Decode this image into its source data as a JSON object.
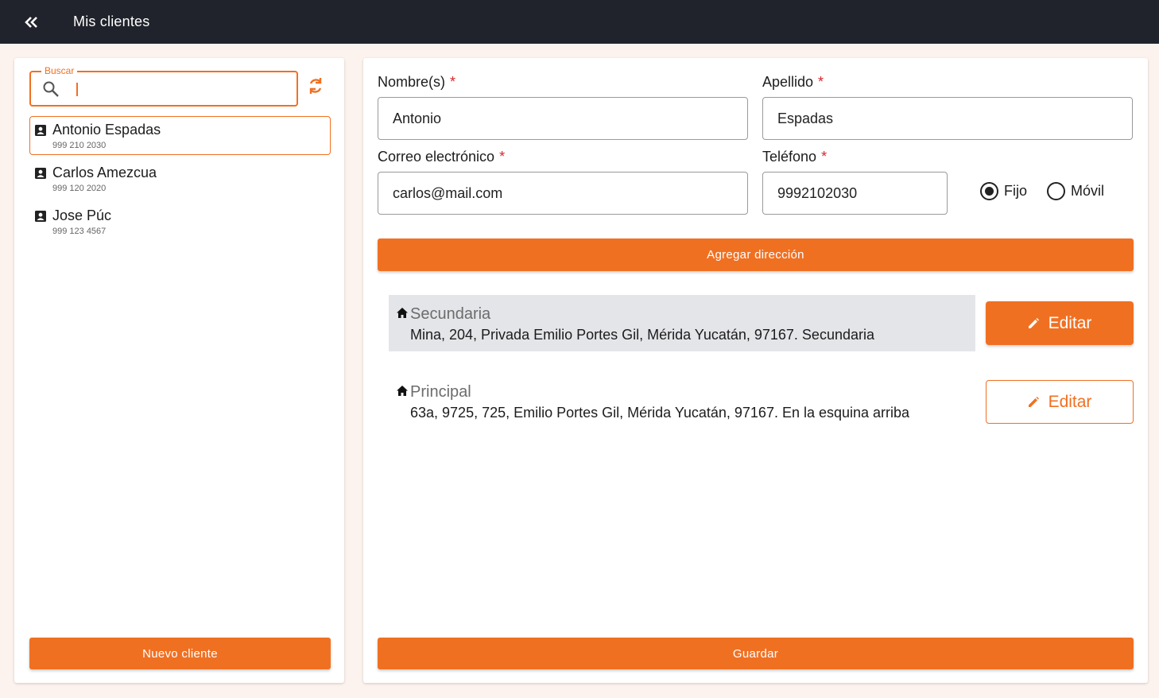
{
  "header": {
    "title": "Mis clientes",
    "back_icon": "double-chevron-left-icon"
  },
  "search": {
    "legend": "Buscar",
    "value": "",
    "icon": "search-icon",
    "refresh_icon": "refresh-icon"
  },
  "clients": [
    {
      "name": "Antonio Espadas",
      "phone": "999 210 2030",
      "selected": true
    },
    {
      "name": "Carlos Amezcua",
      "phone": "999 120 2020",
      "selected": false
    },
    {
      "name": "Jose Púc",
      "phone": "999 123 4567",
      "selected": false
    }
  ],
  "new_client_label": "Nuevo cliente",
  "form": {
    "first_name": {
      "label": "Nombre(s)",
      "required": "*",
      "value": "Antonio"
    },
    "last_name": {
      "label": "Apellido",
      "required": "*",
      "value": "Espadas"
    },
    "email": {
      "label": "Correo electrónico",
      "required": "*",
      "value": "carlos@mail.com"
    },
    "phone": {
      "label": "Teléfono",
      "required": "*",
      "value": "9992102030"
    },
    "phone_type": {
      "options": [
        "Fijo",
        "Móvil"
      ],
      "selected": "Fijo"
    }
  },
  "add_address_label": "Agregar dirección",
  "addresses": [
    {
      "name": "Secundaria",
      "text": "Mina, 204, Privada Emilio Portes Gil, Mérida Yucatán, 97167. Secundaria",
      "edit_label": "Editar"
    },
    {
      "name": "Principal",
      "text": "63a, 9725, 725, Emilio Portes Gil, Mérida Yucatán, 97167. En la esquina arriba",
      "edit_label": "Editar"
    }
  ],
  "save_label": "Guardar",
  "colors": {
    "accent": "#f07022",
    "topbar": "#20232b",
    "required": "#d8262a",
    "background": "#fdf3ee"
  }
}
